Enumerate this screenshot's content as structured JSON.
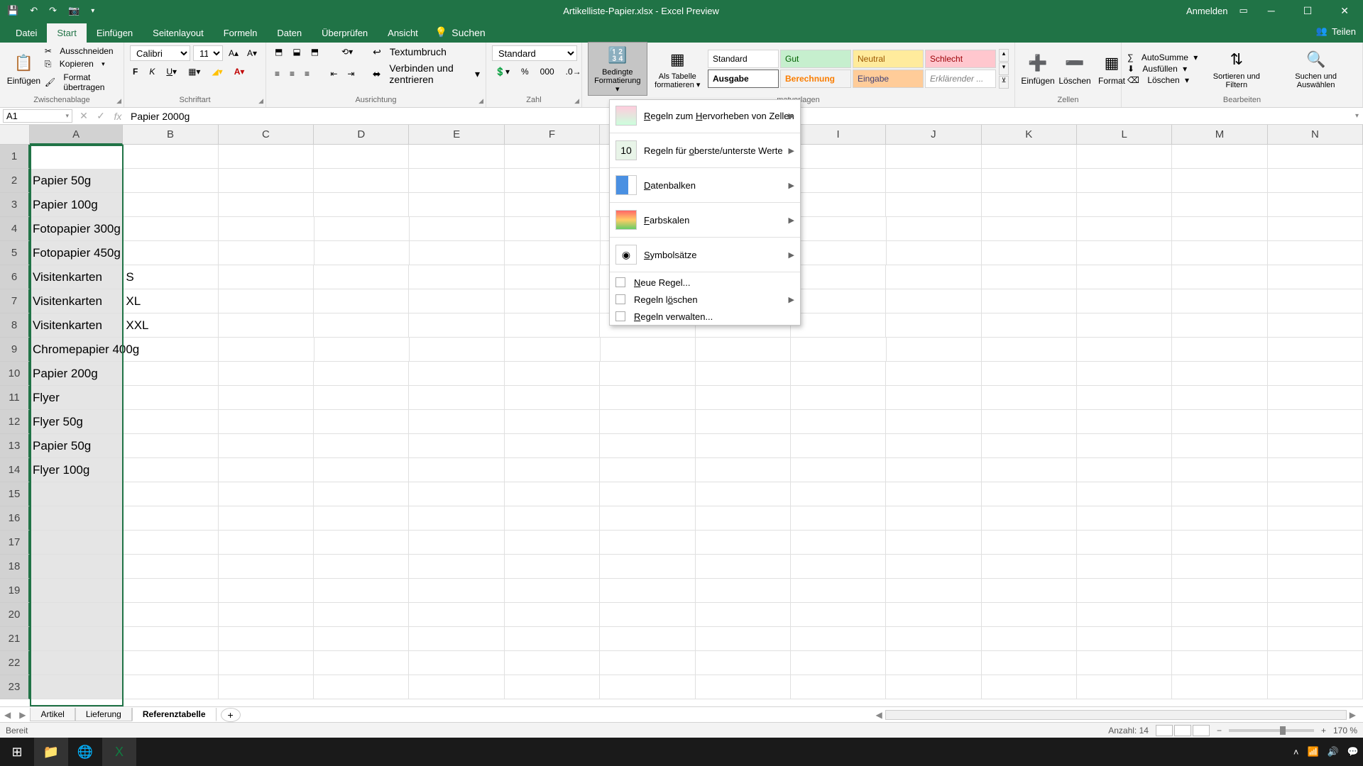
{
  "title_bar": {
    "doc_title": "Artikelliste-Papier.xlsx - Excel Preview",
    "sign_in": "Anmelden"
  },
  "tabs": {
    "file": "Datei",
    "home": "Start",
    "insert": "Einfügen",
    "page_layout": "Seitenlayout",
    "formulas": "Formeln",
    "data": "Daten",
    "review": "Überprüfen",
    "view": "Ansicht",
    "search": "Suchen",
    "share": "Teilen"
  },
  "ribbon": {
    "clipboard": {
      "paste": "Einfügen",
      "cut": "Ausschneiden",
      "copy": "Kopieren",
      "format_painter": "Format übertragen",
      "group": "Zwischenablage"
    },
    "font": {
      "name": "Calibri",
      "size": "11",
      "group": "Schriftart"
    },
    "alignment": {
      "wrap": "Textumbruch",
      "merge": "Verbinden und zentrieren",
      "group": "Ausrichtung"
    },
    "number": {
      "format": "Standard",
      "group": "Zahl"
    },
    "styles": {
      "cond_format": "Bedingte Formatierung",
      "as_table": "Als Tabelle formatieren",
      "s_standard": "Standard",
      "s_gut": "Gut",
      "s_neutral": "Neutral",
      "s_schlecht": "Schlecht",
      "s_ausgabe": "Ausgabe",
      "s_berechnung": "Berechnung",
      "s_eingabe": "Eingabe",
      "s_erklaerender": "Erklärender ...",
      "group": "matvorlagen"
    },
    "cells": {
      "insert": "Einfügen",
      "delete": "Löschen",
      "format": "Format",
      "group": "Zellen"
    },
    "editing": {
      "autosum": "AutoSumme",
      "fill": "Ausfüllen",
      "clear": "Löschen",
      "sort": "Sortieren und Filtern",
      "find": "Suchen und Auswählen",
      "group": "Bearbeiten"
    }
  },
  "dropdown": {
    "highlight_rules": "Regeln zum Hervorheben von Zellen",
    "top_bottom": "Regeln für oberste/unterste Werte",
    "data_bars": "Datenbalken",
    "color_scales": "Farbskalen",
    "icon_sets": "Symbolsätze",
    "new_rule": "Neue Regel...",
    "clear_rules": "Regeln löschen",
    "manage_rules": "Regeln verwalten..."
  },
  "namebox": "A1",
  "formula": "Papier 2000g",
  "columns": [
    "A",
    "B",
    "C",
    "D",
    "E",
    "F",
    "G",
    "H",
    "I",
    "J",
    "K",
    "L",
    "M",
    "N"
  ],
  "rows": [
    {
      "n": 1,
      "a": "Papier 2000g",
      "b": ""
    },
    {
      "n": 2,
      "a": "Papier 50g",
      "b": ""
    },
    {
      "n": 3,
      "a": "Papier 100g",
      "b": ""
    },
    {
      "n": 4,
      "a": "Fotopapier 300g",
      "b": ""
    },
    {
      "n": 5,
      "a": "Fotopapier 450g",
      "b": ""
    },
    {
      "n": 6,
      "a": "Visitenkarten",
      "b": "S"
    },
    {
      "n": 7,
      "a": "Visitenkarten",
      "b": "XL"
    },
    {
      "n": 8,
      "a": "Visitenkarten",
      "b": "XXL"
    },
    {
      "n": 9,
      "a": "Chromepapier 400g",
      "b": ""
    },
    {
      "n": 10,
      "a": "Papier 200g",
      "b": ""
    },
    {
      "n": 11,
      "a": "Flyer",
      "b": ""
    },
    {
      "n": 12,
      "a": "Flyer 50g",
      "b": ""
    },
    {
      "n": 13,
      "a": "Papier 50g",
      "b": ""
    },
    {
      "n": 14,
      "a": "Flyer 100g",
      "b": ""
    },
    {
      "n": 15,
      "a": "",
      "b": ""
    },
    {
      "n": 16,
      "a": "",
      "b": ""
    },
    {
      "n": 17,
      "a": "",
      "b": ""
    },
    {
      "n": 18,
      "a": "",
      "b": ""
    },
    {
      "n": 19,
      "a": "",
      "b": ""
    },
    {
      "n": 20,
      "a": "",
      "b": ""
    },
    {
      "n": 21,
      "a": "",
      "b": ""
    },
    {
      "n": 22,
      "a": "",
      "b": ""
    },
    {
      "n": 23,
      "a": "",
      "b": ""
    }
  ],
  "sheets": {
    "artikel": "Artikel",
    "lieferung": "Lieferung",
    "referenz": "Referenztabelle"
  },
  "statusbar": {
    "ready": "Bereit",
    "count": "Anzahl: 14",
    "zoom": "170 %"
  }
}
